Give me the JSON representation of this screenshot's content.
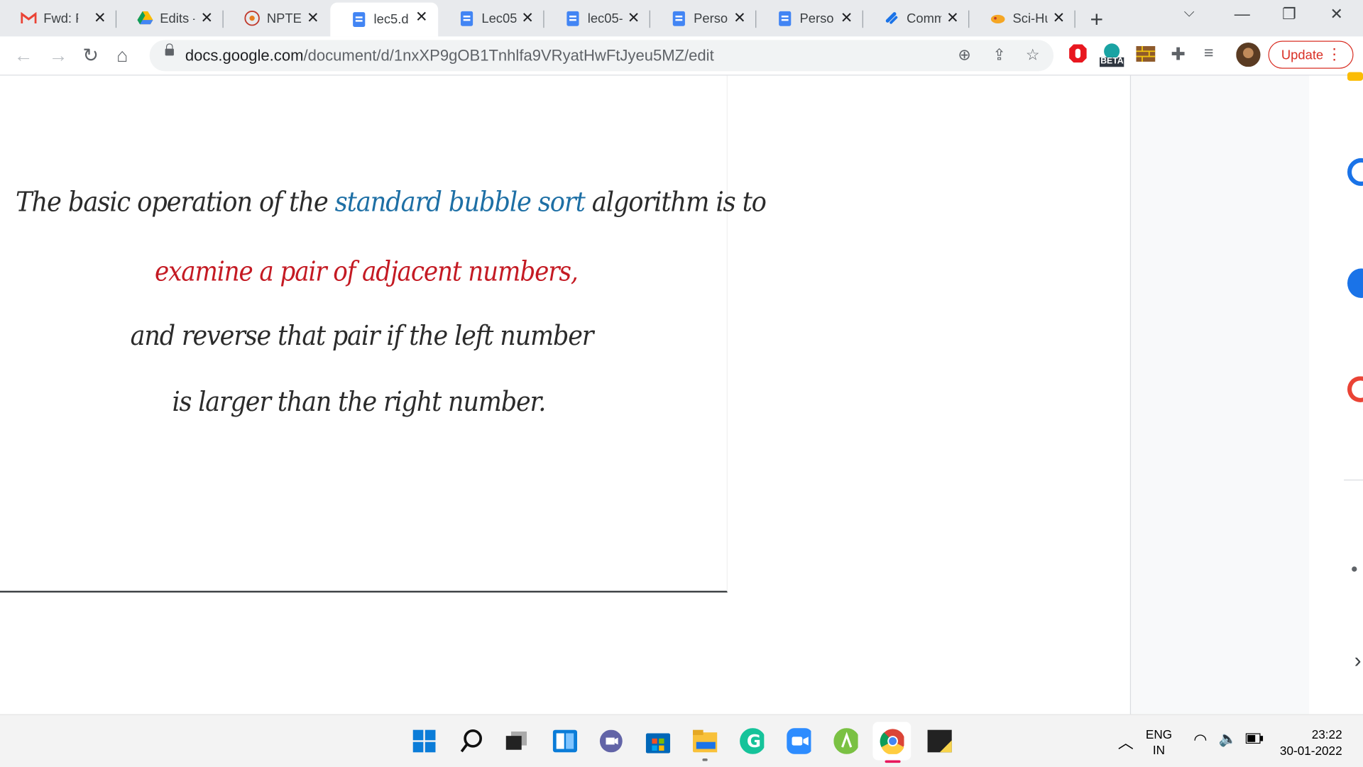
{
  "tabs": [
    {
      "title": "Fwd: R",
      "icon": "gmail-icon"
    },
    {
      "title": "Edits -",
      "icon": "drive-icon"
    },
    {
      "title": "NPTEL",
      "icon": "nptel-icon"
    },
    {
      "title": "lec5.dc",
      "icon": "docs-icon",
      "active": true
    },
    {
      "title": "Lec05-",
      "icon": "docs-icon"
    },
    {
      "title": "lec05-\\",
      "icon": "docs-icon"
    },
    {
      "title": "Person",
      "icon": "docs-icon"
    },
    {
      "title": "Person",
      "icon": "docs-icon"
    },
    {
      "title": "Comm",
      "icon": "link-icon"
    },
    {
      "title": "Sci-Hu",
      "icon": "scihub-icon"
    }
  ],
  "address": {
    "domain": "docs.google.com",
    "path": "/document/d/1nxXP9gOB1Tnhlfa9VRyatHwFtJyeu5MZ/edit"
  },
  "update_label": "Update",
  "beta_label": "BETA",
  "slide": {
    "line1_a": "The basic operation of the ",
    "line1_b": "standard bubble sort",
    "line1_c": " algorithm is to",
    "line2": "examine a pair of adjacent numbers,",
    "line3": "and reverse that pair if the left number",
    "line4": "is larger than the right number."
  },
  "taskbar": {
    "lang_top": "ENG",
    "lang_bottom": "IN",
    "time": "23:22",
    "date": "30-01-2022"
  },
  "colors": {
    "accent_blue": "#1d6fa5",
    "accent_red": "#c41a23",
    "update_red": "#d93025"
  }
}
